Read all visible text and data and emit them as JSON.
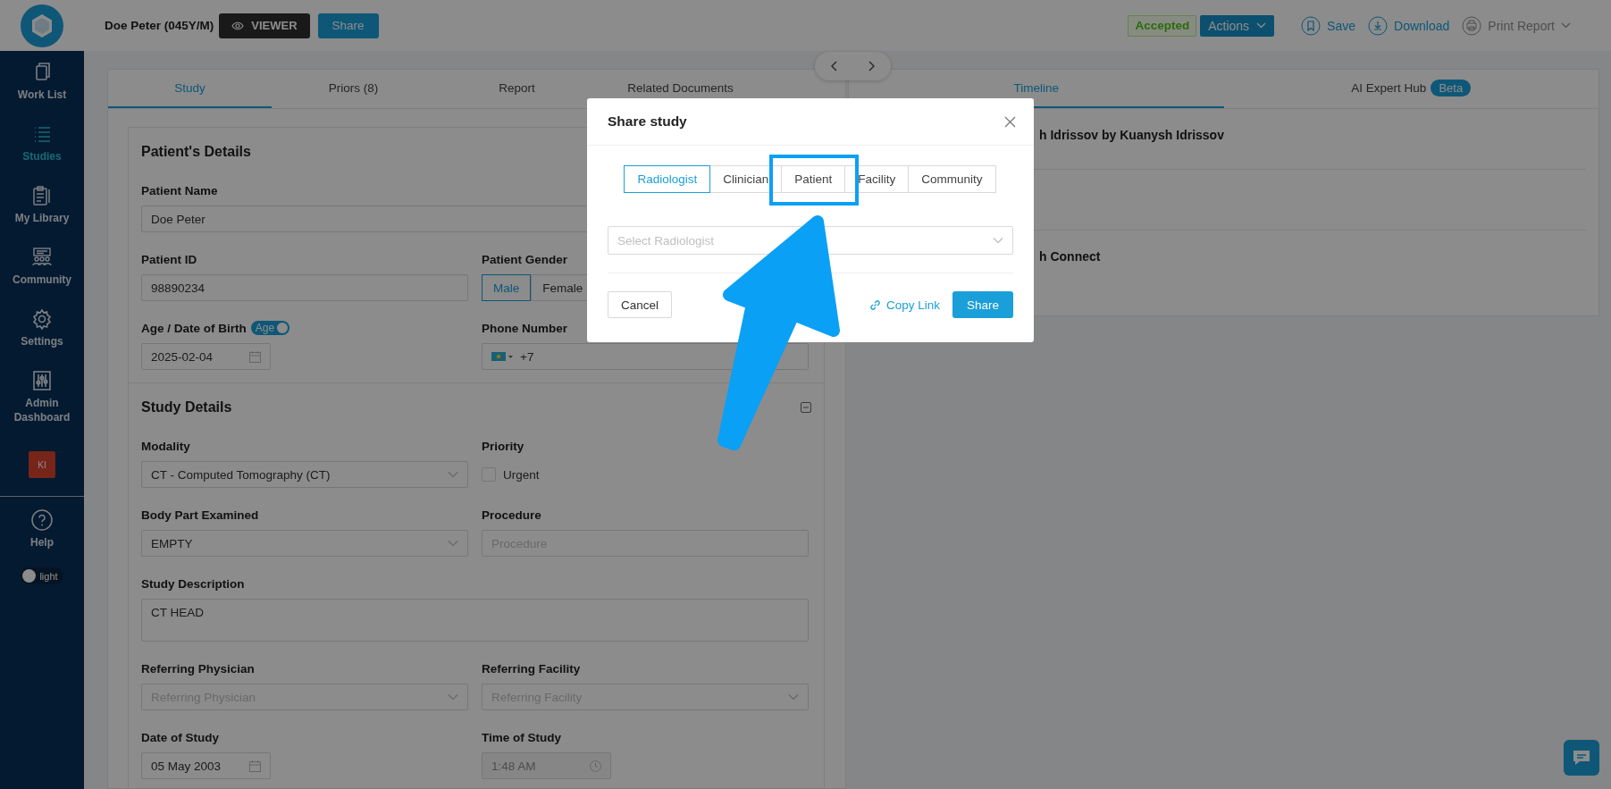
{
  "header": {
    "patient": "Doe Peter (045Y/M)",
    "viewer_button": "VIEWER",
    "share_button": "Share",
    "status": "Accepted",
    "actions_button": "Actions",
    "save": "Save",
    "download": "Download",
    "print_report": {
      "label": "Print Report",
      "disabled": true
    }
  },
  "sidebar": {
    "items": [
      {
        "label": "Work List",
        "selected": false
      },
      {
        "label": "Studies",
        "selected": true
      },
      {
        "label": "My Library",
        "selected": false
      },
      {
        "label": "Community",
        "selected": false
      },
      {
        "label": "Settings",
        "selected": false
      },
      {
        "label": "Admin Dashboard",
        "selected": false
      }
    ],
    "avatar": "KI",
    "help": "Help",
    "theme_toggle": "light"
  },
  "left_panel": {
    "tabs": [
      {
        "label": "Study",
        "selected": true
      },
      {
        "label": "Priors (8)",
        "selected": false
      },
      {
        "label": "Report",
        "selected": false
      },
      {
        "label": "Related Documents",
        "selected": false
      }
    ],
    "sections": [
      {
        "title": "Patient's Details",
        "fields": [
          {
            "label": "Patient Name",
            "kind": "input",
            "value": "Doe Peter",
            "wide": true
          },
          {
            "label": "Patient ID",
            "kind": "input",
            "value": "98890234"
          },
          {
            "label": "Patient Gender",
            "kind": "segmented",
            "options": [
              {
                "label": "Male",
                "selected": true
              },
              {
                "label": "Female",
                "selected": false
              }
            ]
          },
          {
            "label": "Age / Date of Birth",
            "kind": "date",
            "value": "2025-02-04",
            "toggle": {
              "label": "Age",
              "on": true
            }
          },
          {
            "label": "Phone Number",
            "kind": "phone",
            "value": "+7"
          }
        ]
      },
      {
        "title": "Study Details",
        "expanded": true,
        "fields": [
          {
            "label": "Modality",
            "kind": "select",
            "value": "CT - Computed Tomography (CT)"
          },
          {
            "label": "Priority",
            "kind": "checkbox",
            "text": "Urgent",
            "checked": false
          },
          {
            "label": "Body Part Examined",
            "kind": "select",
            "value": "EMPTY"
          },
          {
            "label": "Procedure",
            "kind": "input",
            "placeholder": "Procedure"
          },
          {
            "label": "Study Description",
            "kind": "textarea",
            "value": "CT HEAD",
            "wide": true
          },
          {
            "label": "Referring Physician",
            "kind": "select",
            "placeholder": "Referring Physician"
          },
          {
            "label": "Referring Facility",
            "kind": "select",
            "placeholder": "Referring Facility"
          },
          {
            "label": "Date of Study",
            "kind": "date",
            "value": "05 May 2003"
          },
          {
            "label": "Time of Study",
            "kind": "time",
            "value": "1:48 AM",
            "disabled": true
          }
        ]
      }
    ]
  },
  "right_panel": {
    "tabs": [
      {
        "label": "Timeline",
        "selected": true
      },
      {
        "label": "AI Expert Hub",
        "selected": false,
        "badge": "Beta"
      }
    ],
    "timeline": [
      {
        "text": "h Idrissov by Kuanysh Idrissov"
      },
      {
        "text": "h Connect"
      }
    ]
  },
  "modal": {
    "title": "Share study",
    "tabs": [
      {
        "label": "Radiologist",
        "selected": true
      },
      {
        "label": "Clinician",
        "selected": false
      },
      {
        "label": "Patient",
        "selected": false
      },
      {
        "label": "Facility",
        "selected": false
      },
      {
        "label": "Community",
        "selected": false
      }
    ],
    "select_placeholder": "Select Radiologist",
    "cancel": "Cancel",
    "copy_link": "Copy Link",
    "share": "Share"
  }
}
